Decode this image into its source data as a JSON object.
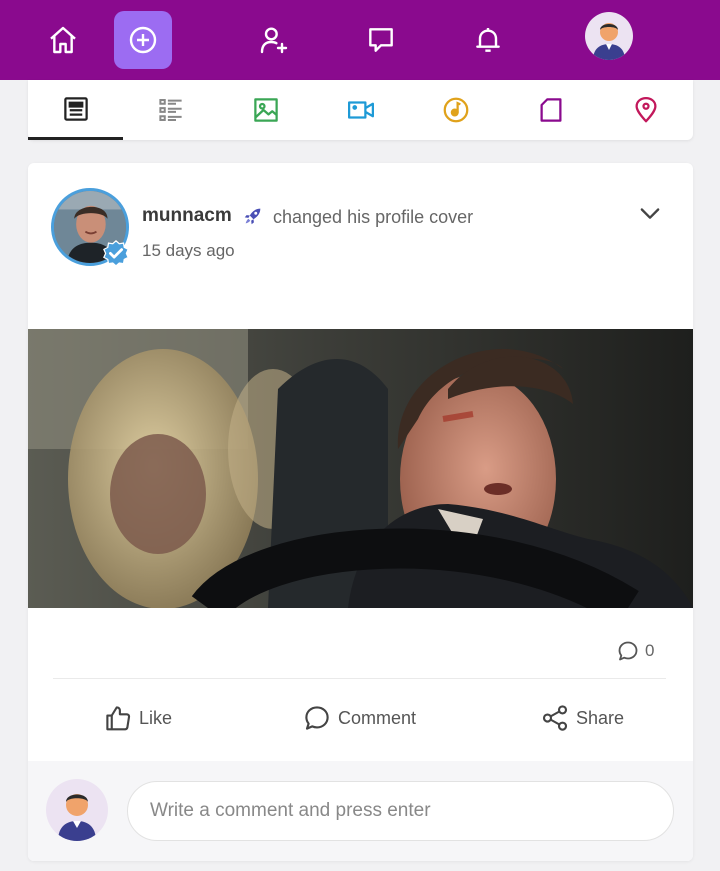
{
  "nav": {
    "brand_color": "#8a0a8e",
    "items": [
      {
        "name": "home",
        "icon": "home-icon"
      },
      {
        "name": "create",
        "icon": "plus-circle-icon",
        "accent": "#9c6cf2"
      },
      {
        "name": "add-friend",
        "icon": "user-plus-icon"
      },
      {
        "name": "messages",
        "icon": "chat-icon"
      },
      {
        "name": "notifications",
        "icon": "bell-icon"
      },
      {
        "name": "profile",
        "icon": "avatar"
      }
    ]
  },
  "composer_tabs": [
    {
      "name": "text",
      "icon": "newspaper-icon",
      "color": "#222222",
      "active": true
    },
    {
      "name": "list",
      "icon": "list-icon",
      "color": "#888888"
    },
    {
      "name": "photo",
      "icon": "image-icon",
      "color": "#3aa655"
    },
    {
      "name": "video",
      "icon": "video-camera-icon",
      "color": "#1e9ad6"
    },
    {
      "name": "audio",
      "icon": "music-disc-icon",
      "color": "#e0a21b"
    },
    {
      "name": "file",
      "icon": "file-icon",
      "color": "#8a0a8e"
    },
    {
      "name": "location",
      "icon": "map-pin-icon",
      "color": "#c2185b"
    }
  ],
  "post": {
    "author": "munnacm",
    "action": "changed his profile cover",
    "time": "15 days ago",
    "verified_color": "#4a9fdc",
    "comment_count": "0",
    "actions": {
      "like": "Like",
      "comment": "Comment",
      "share": "Share"
    }
  },
  "comment_box": {
    "placeholder": "Write a comment and press enter"
  }
}
